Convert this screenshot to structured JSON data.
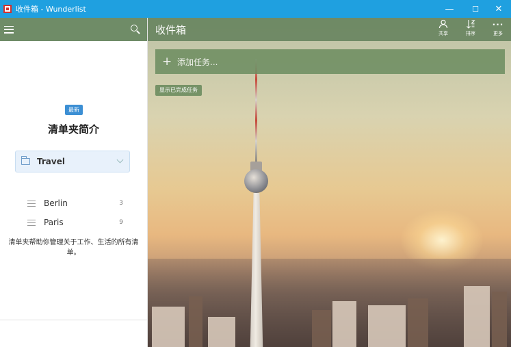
{
  "window": {
    "title": "收件箱 - Wunderlist",
    "minimize": "—",
    "maximize": "☐",
    "close": "✕"
  },
  "sidebar": {
    "badge": "最新",
    "intro_title": "清单夹简介",
    "folder": {
      "label": "Travel"
    },
    "lists": [
      {
        "label": "Berlin",
        "count": "3"
      },
      {
        "label": "Paris",
        "count": "9"
      }
    ],
    "description": "清单夹帮助你管理关于工作、生活的所有清单。"
  },
  "main": {
    "title": "收件箱",
    "toolbar": {
      "share": "共享",
      "sort": "排序",
      "more": "更多"
    },
    "add_task_placeholder": "添加任务...",
    "show_completed": "显示已完成任务"
  },
  "colors": {
    "titlebar": "#1fa0e0",
    "header_green": "#6f8c67",
    "badge_blue": "#3c8fd4"
  },
  "icons": [
    "app-icon",
    "hamburger-icon",
    "search-icon",
    "folder-icon",
    "chevron-down-icon",
    "list-icon",
    "share-icon",
    "sort-icon",
    "more-icon",
    "plus-icon"
  ]
}
